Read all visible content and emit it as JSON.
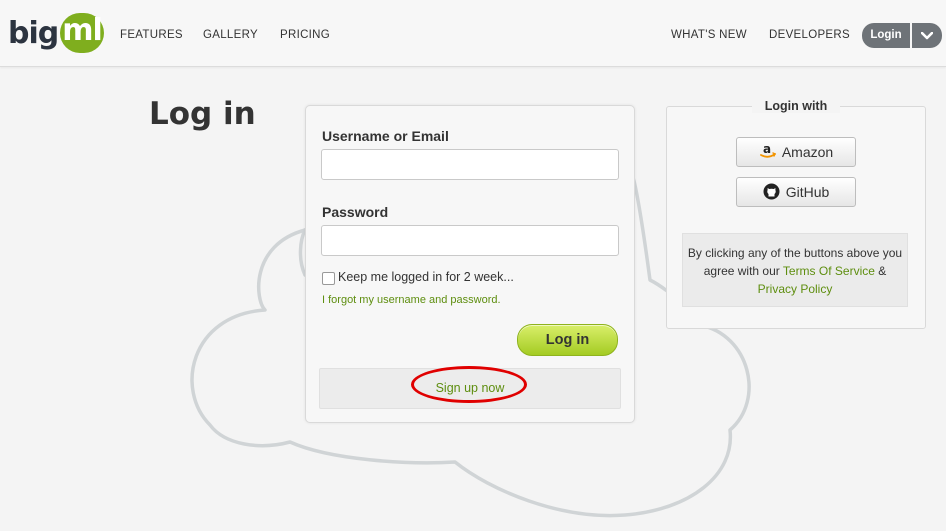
{
  "nav": {
    "logo_big": "big",
    "logo_ml": "ml",
    "left_links": [
      "FEATURES",
      "GALLERY",
      "PRICING"
    ],
    "right_links": [
      "WHAT'S NEW",
      "DEVELOPERS"
    ],
    "login_label": "Login",
    "caret_icon": "chevron-down-icon"
  },
  "page": {
    "title": "Log in"
  },
  "form": {
    "username_label": "Username or Email",
    "username_value": "",
    "password_label": "Password",
    "password_value": "",
    "keep_logged_label": "Keep me logged in for 2 week...",
    "keep_logged_checked": false,
    "forgot_link": "I forgot my username and password.",
    "submit_label": "Log in",
    "signup_link": "Sign up now"
  },
  "login_with": {
    "title": "Login with",
    "amazon_label": "Amazon",
    "amazon_icon": "amazon-icon",
    "github_label": "GitHub",
    "github_icon": "github-icon",
    "terms_prefix": "By clicking any of the buttons above you agree with our",
    "terms_link": "Terms Of Service",
    "terms_and": "&",
    "privacy_link": "Privacy Policy"
  },
  "colors": {
    "brand_green": "#7fae1e",
    "link_green": "#5e8e0f",
    "highlight_red": "#e00000",
    "nav_button_gray": "#6e7378"
  }
}
